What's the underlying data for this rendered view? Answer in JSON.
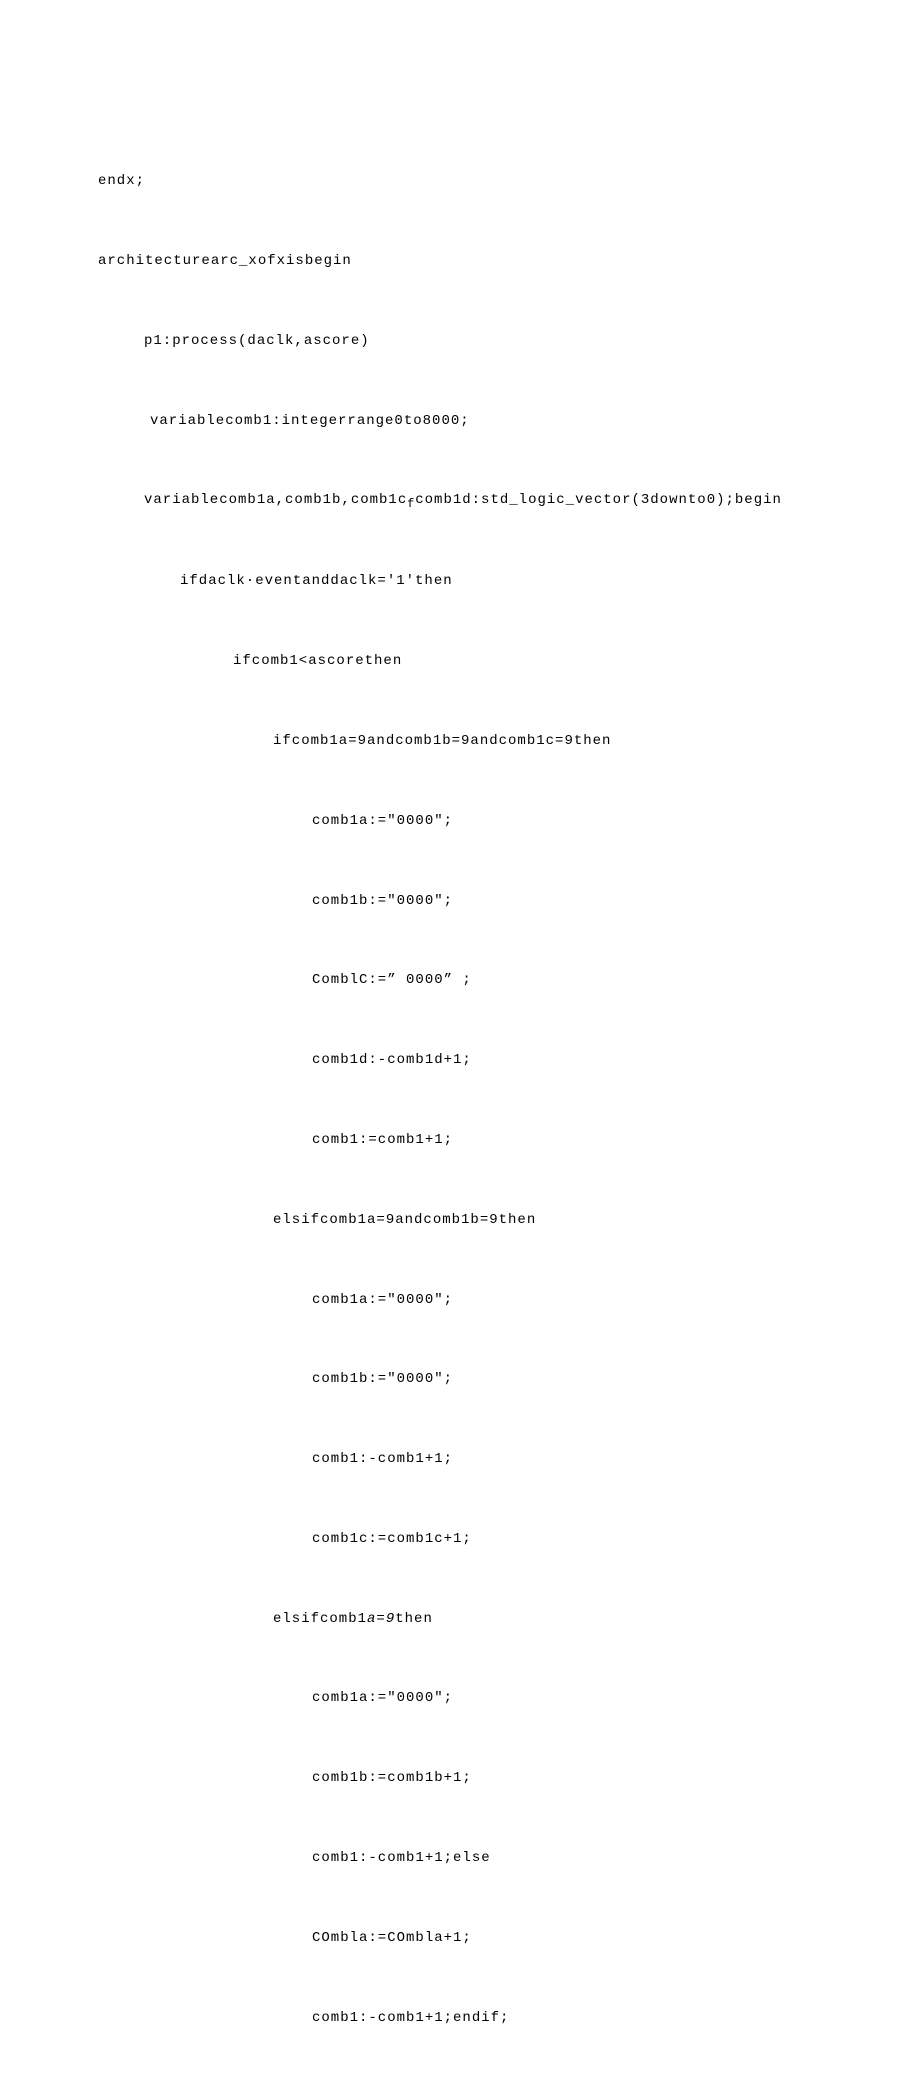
{
  "code": {
    "l1": "endx;",
    "l2": "architecturearc_xofxisbegin",
    "l3": "p1:process(daclk,ascore)",
    "l4": "variablecomb1:integerrange0to8000;",
    "l5_a": "variablecomb1a,comb1b,comb1c",
    "l5_sub": "f",
    "l5_b": "comb1d:std_logic_vector(3downto0);begin",
    "l6": "ifdaclk·eventanddaclk='1'then",
    "l7": "ifcomb1<ascorethen",
    "l8": "ifcomb1a=9andcomb1b=9andcomb1c=9then",
    "l9": "comb1a:=\"0000\";",
    "l10": "comb1b:=\"0000\";",
    "l11": "ComblC:=” 0000” ;",
    "l12": "comb1d:-comb1d+1;",
    "l13": "comb1:=comb1+1;",
    "l14": "elsifcomb1a=9andcomb1b=9then",
    "l15": "comb1a:=\"0000\";",
    "l16": "comb1b:=\"0000\";",
    "l17": "comb1:-comb1+1;",
    "l18": "comb1c:=comb1c+1;",
    "l19_a": "elsifcomb1",
    "l19_b": "a=9",
    "l19_c": "then",
    "l20": "comb1a:=\"0000\";",
    "l21": "comb1b:=comb1b+1;",
    "l22": "comb1:-comb1+1;else",
    "l23": "COmbla:=COmbla+1;",
    "l24": "comb1:-comb1+1;endif;"
  }
}
